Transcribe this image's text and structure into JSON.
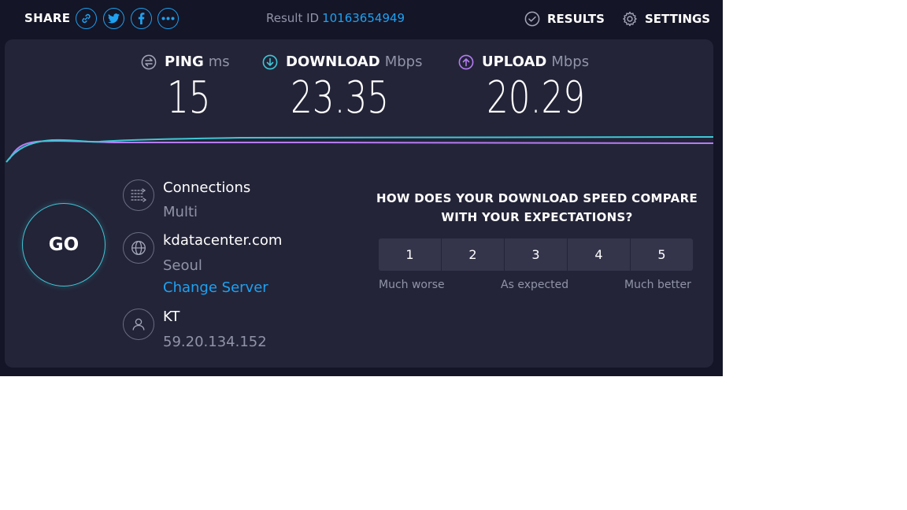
{
  "topbar": {
    "share_label": "SHARE",
    "share_icons": [
      "link-icon",
      "twitter-icon",
      "facebook-icon",
      "more-icon"
    ],
    "result_label": "Result ID",
    "result_id": "10163654949",
    "results_label": "RESULTS",
    "settings_label": "SETTINGS"
  },
  "metrics": {
    "ping": {
      "label": "PING",
      "unit": "ms",
      "value": "15"
    },
    "download": {
      "label": "DOWNLOAD",
      "unit": "Mbps",
      "value": "23.35"
    },
    "upload": {
      "label": "UPLOAD",
      "unit": "Mbps",
      "value": "20.29"
    }
  },
  "go_label": "GO",
  "connections": {
    "title": "Connections",
    "mode": "Multi"
  },
  "server": {
    "name": "kdatacenter.com",
    "location": "Seoul",
    "change_label": "Change Server"
  },
  "isp": {
    "name": "KT",
    "ip": "59.20.134.152"
  },
  "survey": {
    "question": "HOW DOES YOUR DOWNLOAD SPEED COMPARE WITH YOUR EXPECTATIONS?",
    "options": [
      "1",
      "2",
      "3",
      "4",
      "5"
    ],
    "label_low": "Much worse",
    "label_mid": "As expected",
    "label_high": "Much better"
  },
  "colors": {
    "background": "#141526",
    "panel": "#232438",
    "accent": "#1ea1f1",
    "download": "#3fc7d5",
    "upload": "#b57cf2"
  }
}
